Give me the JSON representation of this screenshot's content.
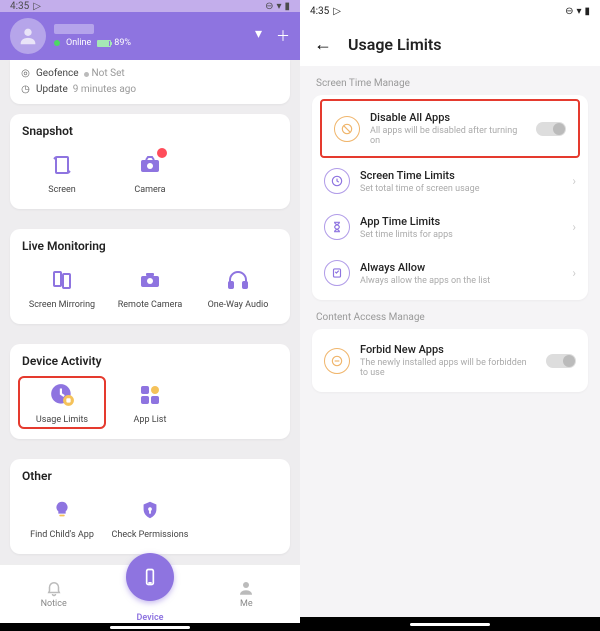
{
  "statusbar": {
    "time": "4:35"
  },
  "left": {
    "header": {
      "status": "Online",
      "battery": "89%"
    },
    "strip": {
      "geofence_label": "Geofence",
      "geofence_value": "Not Set",
      "update_label": "Update",
      "update_value": "9 minutes ago"
    },
    "sections": {
      "snapshot": {
        "title": "Snapshot",
        "items": {
          "screen": "Screen",
          "camera": "Camera"
        }
      },
      "live": {
        "title": "Live Monitoring",
        "items": {
          "mirror": "Screen Mirroring",
          "remote_cam": "Remote Camera",
          "audio": "One-Way Audio"
        }
      },
      "activity": {
        "title": "Device Activity",
        "items": {
          "usage": "Usage Limits",
          "applist": "App List"
        }
      },
      "other": {
        "title": "Other",
        "items": {
          "find": "Find Child's App",
          "perm": "Check Permissions"
        }
      }
    },
    "nav": {
      "notice": "Notice",
      "device": "Device",
      "me": "Me"
    }
  },
  "right": {
    "title": "Usage Limits",
    "section1": "Screen Time Manage",
    "rows": {
      "disable": {
        "title": "Disable All Apps",
        "sub": "All apps will be disabled after turning on"
      },
      "stl": {
        "title": "Screen Time Limits",
        "sub": "Set total time of screen usage"
      },
      "atl": {
        "title": "App Time Limits",
        "sub": "Set time limits for apps"
      },
      "allow": {
        "title": "Always Allow",
        "sub": "Always allow the apps on the list"
      }
    },
    "section2": "Content Access Manage",
    "rows2": {
      "forbid": {
        "title": "Forbid New Apps",
        "sub": "The newly installed apps will be forbidden to use"
      }
    }
  }
}
